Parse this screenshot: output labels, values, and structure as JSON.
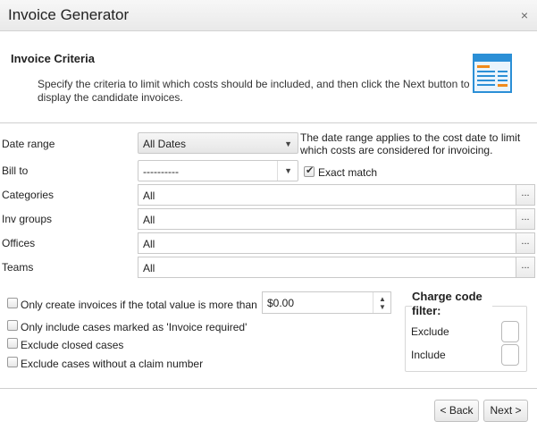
{
  "window": {
    "title": "Invoice Generator",
    "close_glyph": "×"
  },
  "header": {
    "title": "Invoice Criteria",
    "description": "Specify the criteria to limit which costs should be included, and then click the Next button to display the candidate invoices.",
    "icon": "invoice-table-icon"
  },
  "form": {
    "date_range": {
      "label": "Date range",
      "value": "All Dates",
      "note": "The date range applies to the cost date to limit which costs are considered for invoicing."
    },
    "bill_to": {
      "label": "Bill to",
      "value": "----------",
      "exact_match_label": "Exact match",
      "exact_match_checked": true
    },
    "categories": {
      "label": "Categories",
      "value": "All"
    },
    "inv_groups": {
      "label": "Inv groups",
      "value": "All"
    },
    "offices": {
      "label": "Offices",
      "value": "All"
    },
    "teams": {
      "label": "Teams",
      "value": "All"
    },
    "browse_label": "..."
  },
  "options": {
    "min_total_label": "Only create invoices if the total value is more than",
    "min_total_value": "$0.00",
    "invoice_required_label": "Only include cases marked as 'Invoice required'",
    "exclude_closed_label": "Exclude closed cases",
    "exclude_no_claim_label": "Exclude cases without a claim number"
  },
  "charge_code_filter": {
    "title": "Charge code filter:",
    "exclude_label": "Exclude",
    "include_label": "Include"
  },
  "footer": {
    "back_label": "< Back",
    "next_label": "Next >"
  },
  "colors": {
    "icon_blue": "#2b8fd6",
    "icon_orange": "#f08a1c"
  }
}
